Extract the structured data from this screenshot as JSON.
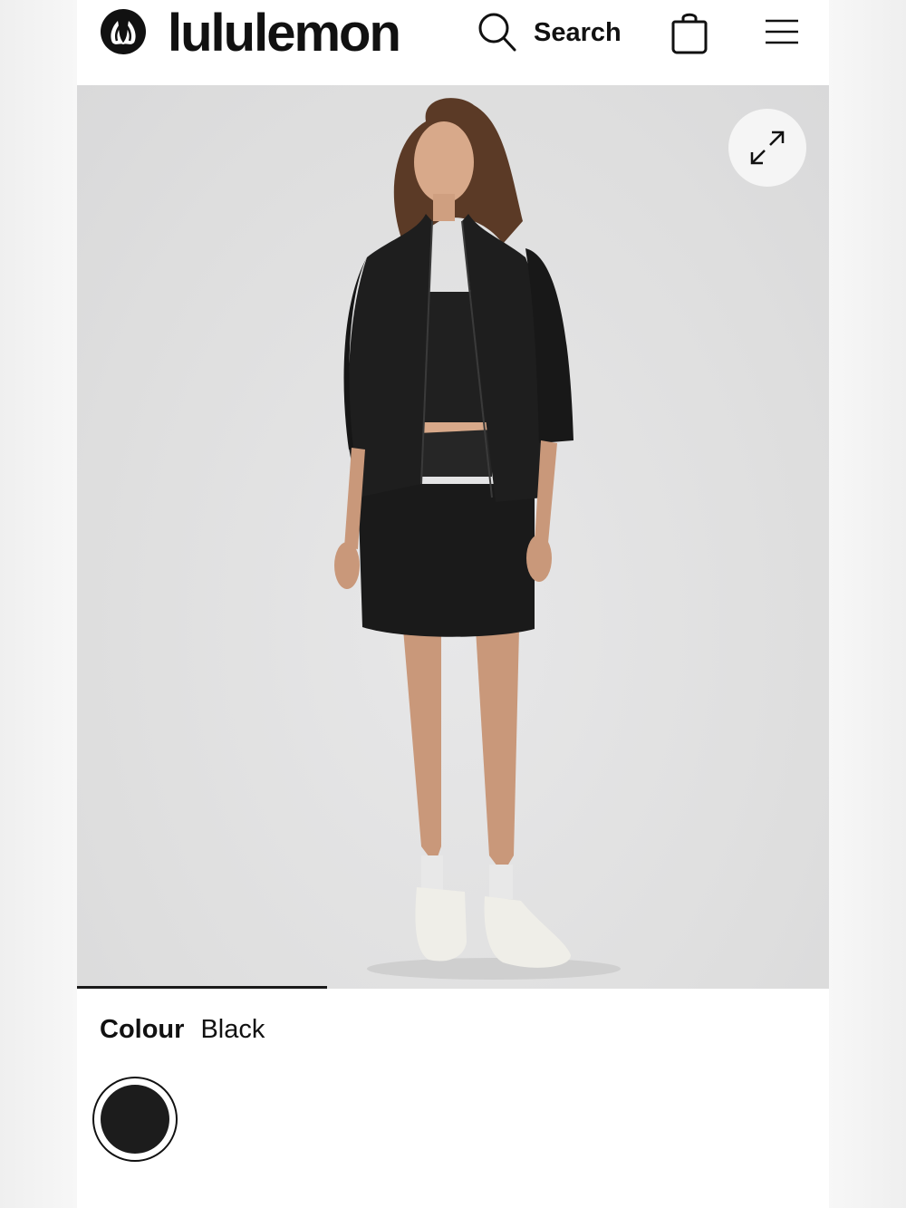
{
  "header": {
    "brand_name": "lululemon",
    "search_label": "Search",
    "logo_icon": "lululemon-logo-icon",
    "search_icon": "search-icon",
    "bag_icon": "shopping-bag-icon",
    "menu_icon": "hamburger-menu-icon"
  },
  "gallery": {
    "expand_icon": "expand-icon",
    "progress_fraction": 0.333
  },
  "colour": {
    "heading": "Colour",
    "selected": "Black",
    "swatches": [
      {
        "name": "Black",
        "hex": "#1c1c1c"
      }
    ]
  },
  "colors": {
    "text": "#111111",
    "background": "#ffffff",
    "image_background": "#dedede"
  }
}
